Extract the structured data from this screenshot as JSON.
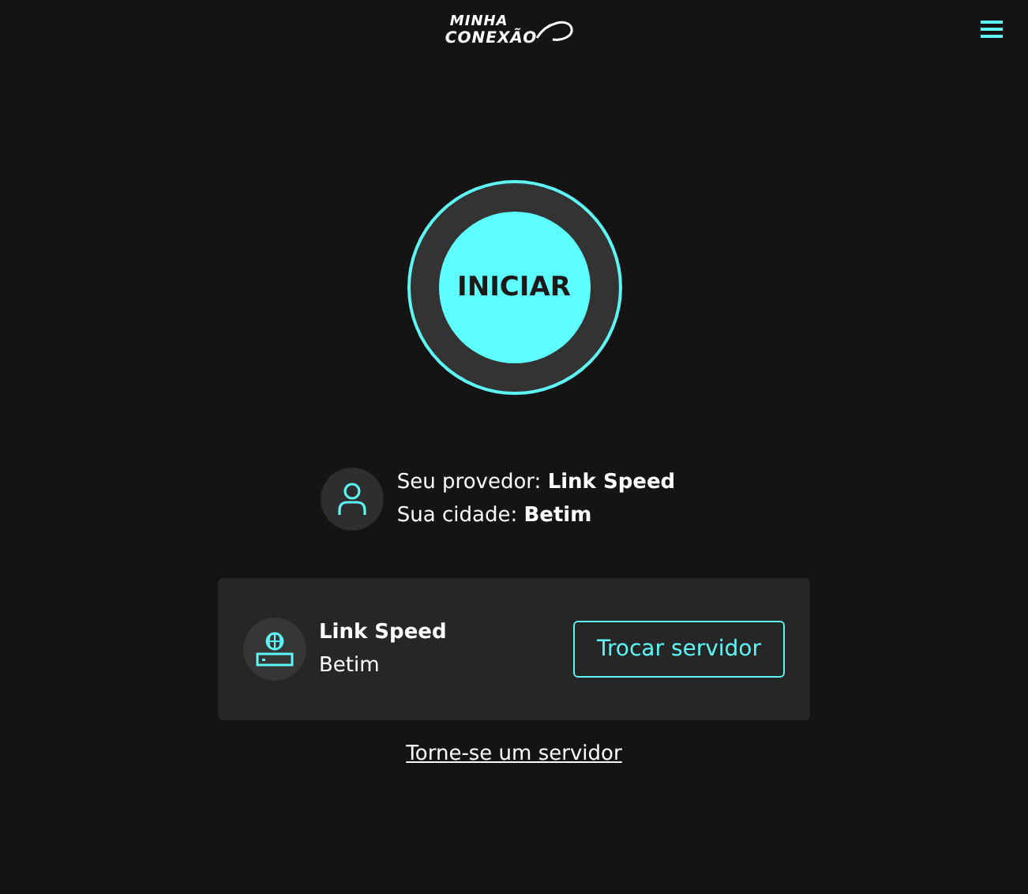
{
  "header": {
    "logo_line_1": "MINHA",
    "logo_line_2": "CONEXÃO"
  },
  "start_button": {
    "label": "INICIAR"
  },
  "info": {
    "provider": "Seu provedor: **Link Speed**",
    "city": "Sua cidade: **Betim**"
  },
  "server_card": {
    "name": "Link Speed",
    "city": "Betim",
    "button": "Trocar servidor"
  },
  "become_server_link": "Torne-se um servidor"
}
